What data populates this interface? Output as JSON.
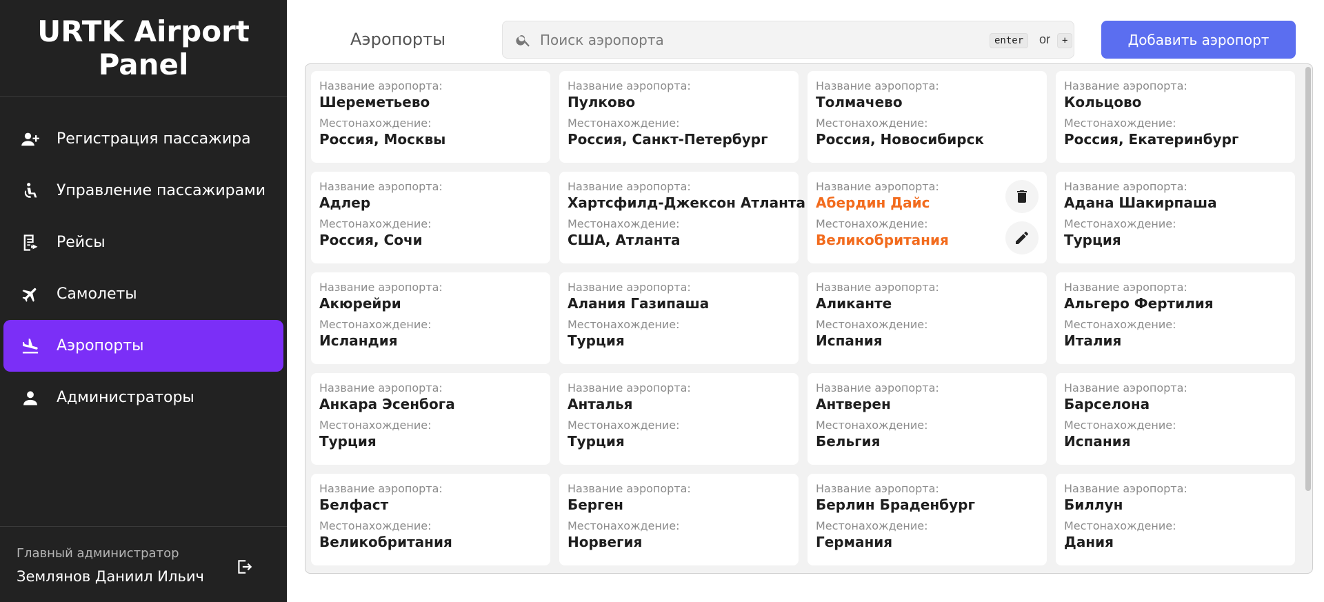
{
  "sidebar": {
    "logo": "URTK Airport Panel",
    "items": [
      {
        "label": "Регистрация пассажира",
        "icon": "person-add-icon",
        "active": false
      },
      {
        "label": "Управление пассажирами",
        "icon": "accessible-icon",
        "active": false
      },
      {
        "label": "Рейсы",
        "icon": "flights-list-icon",
        "active": false
      },
      {
        "label": "Самолеты",
        "icon": "airplane-icon",
        "active": false
      },
      {
        "label": "Аэропорты",
        "icon": "airport-icon",
        "active": true
      },
      {
        "label": "Администраторы",
        "icon": "person-icon",
        "active": false
      }
    ],
    "user": {
      "role": "Главный администратор",
      "name": "Землянов Даниил Ильич"
    }
  },
  "header": {
    "title": "Аэропорты",
    "search_placeholder": "Поиск аэропорта",
    "kbd_enter": "enter",
    "kbd_or": "or",
    "kbd_plus": "+",
    "add_button": "Добавить аэропорт"
  },
  "labels": {
    "name": "Название аэропорта:",
    "location": "Местонахождение:"
  },
  "airports": [
    {
      "name": "Шереметьево",
      "location": "Россия, Москвы"
    },
    {
      "name": "Пулково",
      "location": "Россия, Санкт-Петербург"
    },
    {
      "name": "Толмачево",
      "location": "Россия, Новосибирск"
    },
    {
      "name": "Кольцово",
      "location": "Россия, Екатеринбург"
    },
    {
      "name": "Адлер",
      "location": "Россия, Сочи"
    },
    {
      "name": "Хартсфилд-Джексон Атланта",
      "location": "США, Атланта"
    },
    {
      "name": "Абердин Дайс",
      "location": "Великобритания",
      "highlighted": true
    },
    {
      "name": "Адана Шакирпаша",
      "location": "Турция"
    },
    {
      "name": "Акюрейри",
      "location": "Исландия"
    },
    {
      "name": "Алания Газипаша",
      "location": "Турция"
    },
    {
      "name": "Аликанте",
      "location": "Испания"
    },
    {
      "name": "Альгеро Фертилия",
      "location": "Италия"
    },
    {
      "name": "Анкара Эсенбога",
      "location": "Турция"
    },
    {
      "name": "Анталья",
      "location": "Турция"
    },
    {
      "name": "Антверен",
      "location": "Бельгия"
    },
    {
      "name": "Барселона",
      "location": "Испания"
    },
    {
      "name": "Белфаст",
      "location": "Великобритания"
    },
    {
      "name": "Берген",
      "location": "Норвегия"
    },
    {
      "name": "Берлин Браденбург",
      "location": "Германия"
    },
    {
      "name": "Биллун",
      "location": "Дания"
    }
  ],
  "colors": {
    "sidebar_bg": "#222222",
    "active": "#7b2ff7",
    "button": "#5b6ef0",
    "highlight": "#f26b1d"
  }
}
